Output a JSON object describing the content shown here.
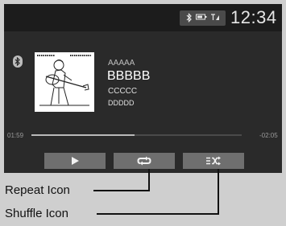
{
  "status": {
    "bluetooth_icon": "bluetooth-icon",
    "battery_icon": "battery-icon",
    "signal_icon": "signal-icon",
    "clock": "12:34"
  },
  "source_icon": "bluetooth-icon",
  "track": {
    "artist": "AAAAA",
    "title": "BBBBB",
    "album": "CCCCC",
    "genre": "DDDDD",
    "album_art": "guitarist-artwork"
  },
  "progress": {
    "elapsed": "01:59",
    "remaining": "-02:05",
    "fraction": 0.49
  },
  "controls": {
    "play_icon": "play-icon",
    "repeat_icon": "repeat-icon",
    "shuffle_icon": "shuffle-icon"
  },
  "callouts": {
    "repeat": "Repeat Icon",
    "shuffle": "Shuffle Icon"
  },
  "colors": {
    "screen_bg": "#2a2a2a",
    "statusbar_bg": "#1c1c1c",
    "button_bg": "#6f6f6f",
    "frame_bg": "#cfcfcf"
  }
}
